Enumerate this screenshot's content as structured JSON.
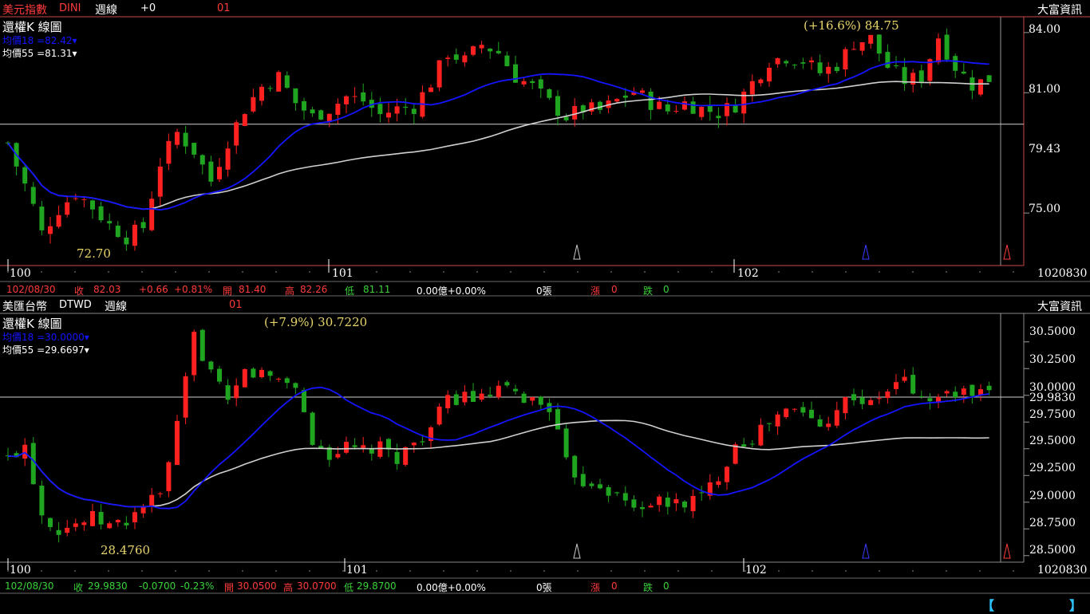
{
  "colors": {
    "up": "#ff2020",
    "down": "#1fa51f",
    "ma18": "#1414ff",
    "ma55": "#d0d0d0",
    "grid": "#5a5a5a",
    "frame": "#c84848"
  },
  "panels": [
    {
      "id": "dini",
      "header": {
        "name": "美元指數",
        "code": "DINI",
        "period": "週線",
        "delta": "+0",
        "code2": "01",
        "brand": "大富資訊"
      },
      "legend": {
        "title": "還權K 線圖",
        "ma18": "均價18 =82.42▾",
        "ma55": "均價55 =81.31▾"
      },
      "peak_label": "(+16.6%) 84.75",
      "low_label": "72.70",
      "current_label": "79.43",
      "axis_ticks": [
        "84.00",
        "81.00",
        "75.00"
      ],
      "years": [
        "100",
        "101",
        "102"
      ],
      "date_code": "1020830",
      "status": {
        "date": "102/08/30",
        "close_k": "收",
        "close": "82.03",
        "chg": "+0.66",
        "pct": "+0.81%",
        "open_k": "開",
        "open": "81.40",
        "high_k": "高",
        "high": "82.26",
        "low_k": "低",
        "low": "81.11",
        "amount": "0.00億+0.00%",
        "vol": "0張",
        "up_k": "漲",
        "up": "0",
        "down_k": "跌",
        "down": "0"
      }
    },
    {
      "id": "dtwd",
      "header": {
        "name": "美匯台幣",
        "code": "DTWD",
        "period": "週線",
        "delta": "",
        "code2": "01",
        "brand": "大富資訊"
      },
      "legend": {
        "title": "還權K 線圖",
        "ma18": "均價18 =30.0000▾",
        "ma55": "均價55 =29.6697▾"
      },
      "peak_label": "(+7.9%) 30.7220",
      "low_label": "28.4760",
      "current_label": "29.9830",
      "axis_ticks": [
        "30.5000",
        "30.2500",
        "30.0000",
        "29.7500",
        "29.5000",
        "29.2500",
        "29.0000",
        "28.7500",
        "28.5000"
      ],
      "years": [
        "100",
        "101",
        "102"
      ],
      "date_code": "1020830",
      "status": {
        "date": "102/08/30",
        "close_k": "收",
        "close": "29.9830",
        "chg": "-0.0700",
        "pct": "-0.23%",
        "open_k": "開",
        "open": "30.0500",
        "high_k": "高",
        "high": "30.0700",
        "low_k": "低",
        "low": "29.8700",
        "amount": "0.00億+0.00%",
        "vol": "0張",
        "up_k": "漲",
        "up": "0",
        "down_k": "跌",
        "down": "0"
      }
    }
  ],
  "chart_data": [
    {
      "type": "candlestick",
      "title": "美元指數 DINI 週線",
      "ylim": [
        72.7,
        84.75
      ],
      "x_periods": [
        "100",
        "101",
        "102"
      ],
      "anchors": [
        [
          0,
          78.5
        ],
        [
          3,
          76.8
        ],
        [
          5,
          76.0
        ],
        [
          8,
          74.0
        ],
        [
          12,
          75.2
        ],
        [
          16,
          76.0
        ],
        [
          20,
          75.3
        ],
        [
          24,
          74.4
        ],
        [
          28,
          73.8
        ],
        [
          32,
          74.3
        ],
        [
          36,
          77.5
        ],
        [
          40,
          79.0
        ],
        [
          44,
          78.1
        ],
        [
          48,
          76.6
        ],
        [
          52,
          78.6
        ],
        [
          56,
          80.2
        ],
        [
          60,
          81.3
        ],
        [
          64,
          81.8
        ],
        [
          68,
          80.5
        ],
        [
          72,
          79.8
        ],
        [
          76,
          80.2
        ],
        [
          80,
          80.8
        ],
        [
          84,
          80.6
        ],
        [
          88,
          79.9
        ],
        [
          92,
          80.2
        ],
        [
          96,
          80.3
        ],
        [
          100,
          81.5
        ],
        [
          104,
          83.0
        ],
        [
          108,
          82.6
        ],
        [
          112,
          83.4
        ],
        [
          116,
          83.0
        ],
        [
          120,
          81.8
        ],
        [
          124,
          81.3
        ],
        [
          128,
          80.5
        ],
        [
          132,
          79.8
        ],
        [
          136,
          80.2
        ],
        [
          140,
          80.1
        ],
        [
          144,
          80.6
        ],
        [
          148,
          81.1
        ],
        [
          152,
          80.5
        ],
        [
          156,
          80.1
        ],
        [
          160,
          80.5
        ],
        [
          164,
          80.2
        ],
        [
          168,
          80.0
        ],
        [
          172,
          80.4
        ],
        [
          176,
          81.5
        ],
        [
          180,
          82.6
        ],
        [
          184,
          82.8
        ],
        [
          188,
          82.6
        ],
        [
          192,
          82.0
        ],
        [
          196,
          82.4
        ],
        [
          200,
          83.5
        ],
        [
          204,
          83.7
        ],
        [
          208,
          82.3
        ],
        [
          212,
          81.6
        ],
        [
          216,
          81.8
        ],
        [
          220,
          83.8
        ],
        [
          224,
          82.3
        ],
        [
          228,
          81.4
        ],
        [
          232,
          81.7
        ]
      ],
      "ma18_value": 82.42,
      "ma55_value": 81.31,
      "peak": 84.75,
      "peak_pct": "+16.6%",
      "low": 72.7,
      "current": 79.43
    },
    {
      "type": "candlestick",
      "title": "美匯台幣 DTWD 週線",
      "ylim": [
        28.476,
        30.722
      ],
      "x_periods": [
        "100",
        "101",
        "102"
      ],
      "anchors": [
        [
          0,
          29.4
        ],
        [
          4,
          29.55
        ],
        [
          8,
          28.9
        ],
        [
          12,
          28.75
        ],
        [
          16,
          28.8
        ],
        [
          20,
          28.85
        ],
        [
          24,
          28.78
        ],
        [
          28,
          28.82
        ],
        [
          32,
          28.98
        ],
        [
          36,
          29.05
        ],
        [
          40,
          29.7
        ],
        [
          44,
          30.55
        ],
        [
          48,
          30.22
        ],
        [
          52,
          29.9
        ],
        [
          56,
          30.22
        ],
        [
          60,
          30.2
        ],
        [
          64,
          30.15
        ],
        [
          68,
          30.1
        ],
        [
          72,
          29.55
        ],
        [
          76,
          29.45
        ],
        [
          80,
          29.5
        ],
        [
          84,
          29.48
        ],
        [
          88,
          29.5
        ],
        [
          92,
          29.42
        ],
        [
          96,
          29.55
        ],
        [
          100,
          29.7
        ],
        [
          104,
          29.95
        ],
        [
          108,
          30.0
        ],
        [
          112,
          29.95
        ],
        [
          116,
          30.05
        ],
        [
          120,
          30.0
        ],
        [
          124,
          29.95
        ],
        [
          128,
          29.9
        ],
        [
          132,
          29.35
        ],
        [
          136,
          29.2
        ],
        [
          140,
          29.18
        ],
        [
          144,
          29.05
        ],
        [
          148,
          28.95
        ],
        [
          152,
          29.0
        ],
        [
          156,
          28.98
        ],
        [
          160,
          29.0
        ],
        [
          164,
          29.05
        ],
        [
          168,
          29.25
        ],
        [
          172,
          29.55
        ],
        [
          176,
          29.6
        ],
        [
          180,
          29.75
        ],
        [
          184,
          29.85
        ],
        [
          188,
          29.85
        ],
        [
          192,
          29.7
        ],
        [
          196,
          29.9
        ],
        [
          200,
          30.0
        ],
        [
          204,
          29.9
        ],
        [
          208,
          30.05
        ],
        [
          212,
          30.15
        ],
        [
          216,
          29.95
        ],
        [
          220,
          29.98
        ],
        [
          224,
          30.02
        ],
        [
          232,
          29.983
        ]
      ],
      "ma18_value": 30.0,
      "ma55_value": 29.6697,
      "peak": 30.722,
      "peak_pct": "+7.9%",
      "low": 28.476,
      "current": 29.983
    }
  ]
}
